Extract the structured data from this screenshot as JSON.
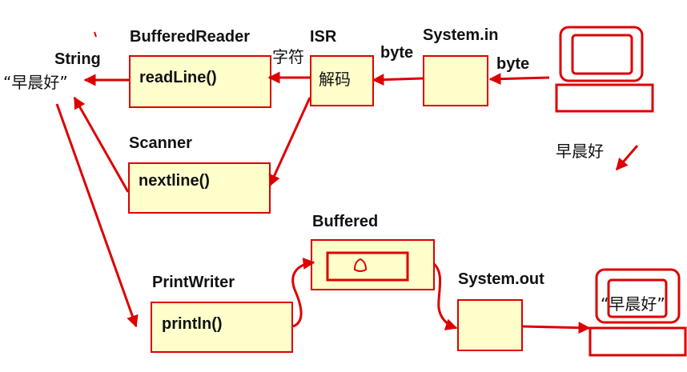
{
  "labels": {
    "string": "String",
    "string_value": "“早晨好”",
    "buffered_reader": "BufferedReader",
    "isr": "ISR",
    "system_in": "System.in",
    "byte_1": "byte",
    "byte_2": "byte",
    "chars": "字符",
    "read_line": "readLine()",
    "decode": "解码",
    "scanner": "Scanner",
    "next_line": "nextline()",
    "good_morning": "早晨好",
    "buffered": "Buffered",
    "print_writer": "PrintWriter",
    "println": "println()",
    "system_out": "System.out",
    "output_text": "“早晨好”"
  },
  "colors": {
    "arrow": "#dd0000",
    "box_fill": "#ffffcc",
    "box_stroke": "#dd0000"
  }
}
